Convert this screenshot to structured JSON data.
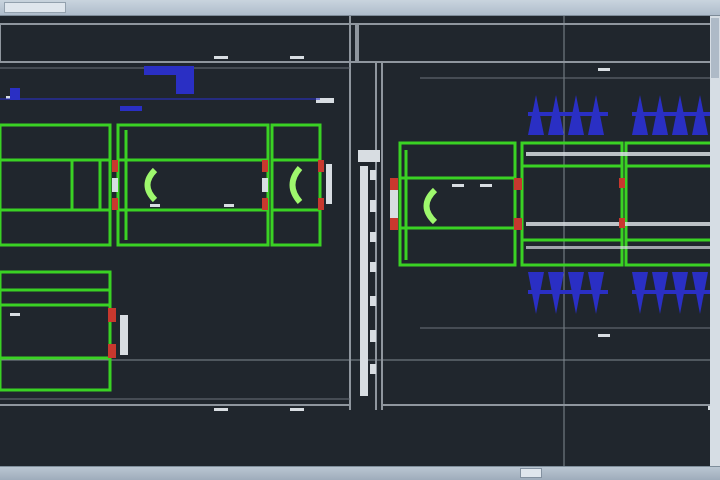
{
  "window": {
    "title": "",
    "status": ""
  },
  "drawing": {
    "colors": {
      "background": "#20262d",
      "frame": "#8f969e",
      "green_dark": "#1e8a12",
      "green": "#3ad224",
      "green_light": "#9ef86d",
      "red": "#c8382e",
      "blue": "#2a2fc4",
      "white": "#d8dde2"
    },
    "icons": [
      "crosshair-icon"
    ]
  }
}
